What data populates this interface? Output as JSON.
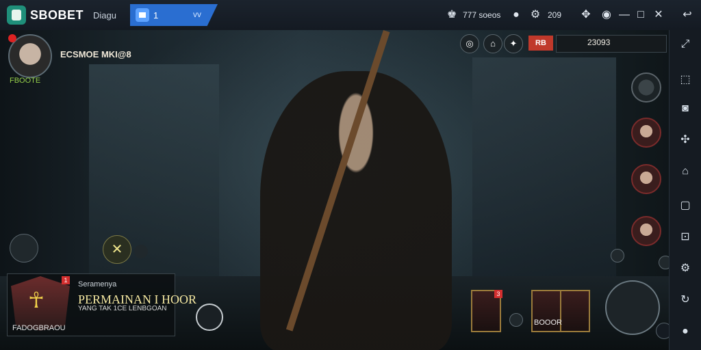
{
  "topbar": {
    "brand": "SBOBET",
    "app_title": "Diagu",
    "tab_label": "1",
    "tab_chevron": "vv",
    "status_text": "777 soeos",
    "counter_text": "209"
  },
  "player": {
    "name": "ECSMOE MKI@8",
    "level": "FBOOTE"
  },
  "resources": {
    "red_label": "RB",
    "value": "23093"
  },
  "mission_card": {
    "subtitle": "Seramenya",
    "title": "PERMAINAN I HOOR",
    "small_text": "YANG TAK 1CE LENBGOAN",
    "footer": "FADOGBRAOU",
    "badge": "1"
  },
  "inventory": {
    "label": "BOOOR",
    "badge": "3"
  },
  "icons": {
    "brand_logo": "bluestacks-icon",
    "home": "home-icon",
    "user": "user-icon",
    "gear": "gear-icon",
    "minimize": "minimize-icon",
    "maximize": "maximize-icon",
    "close": "close-icon",
    "back": "back-icon",
    "sidebar_items": [
      "expand-icon",
      "screenshot-icon",
      "camera-icon",
      "puzzle-icon",
      "layers-icon",
      "square-icon",
      "apk-icon",
      "settings-icon",
      "rotate-icon",
      "more-icon"
    ]
  },
  "colors": {
    "accent": "#2a6ed1",
    "badge_red": "#c0392b",
    "level_green": "#96d04a"
  }
}
